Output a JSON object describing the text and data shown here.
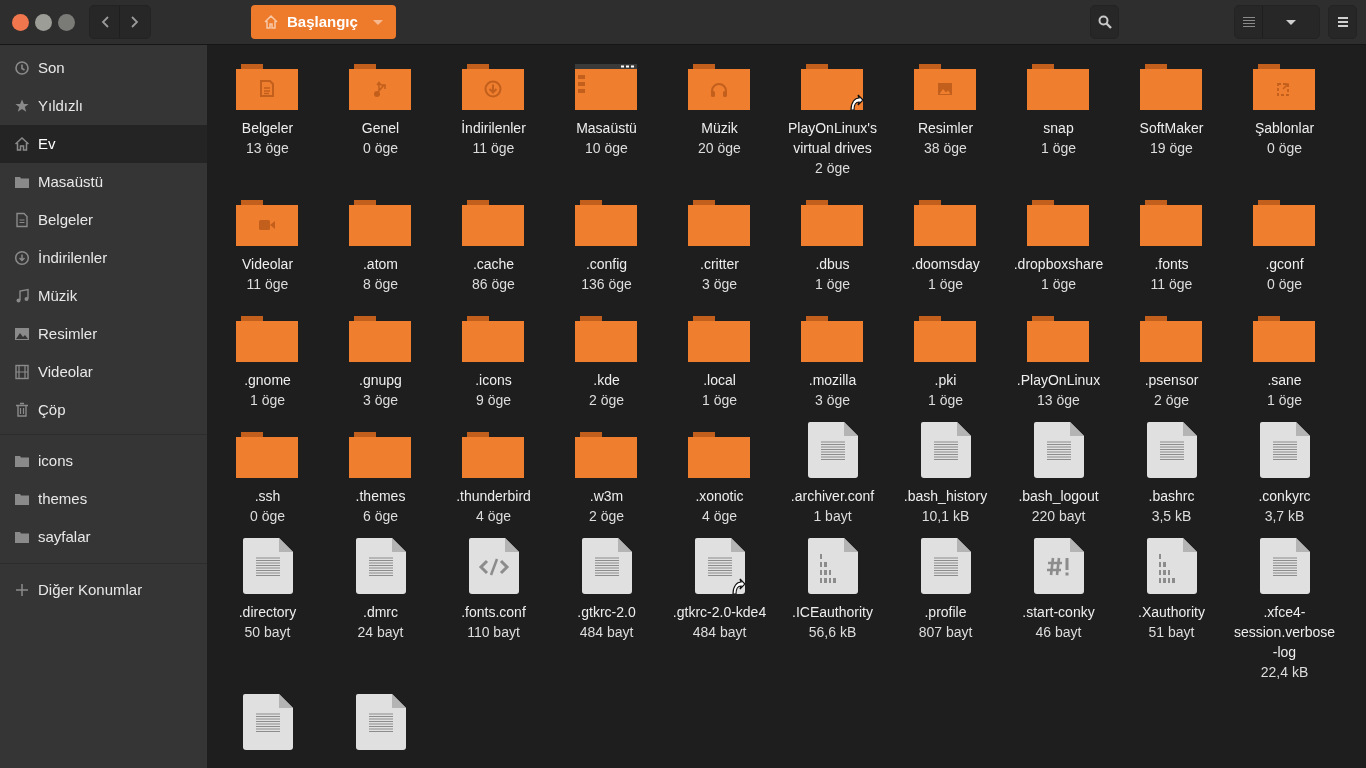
{
  "header": {
    "location": "Başlangıç"
  },
  "sidebar": {
    "sections": [
      {
        "items": [
          {
            "label": "Son",
            "kind": "recent",
            "selected": false
          },
          {
            "label": "Yıldızlı",
            "kind": "starred",
            "selected": false
          },
          {
            "label": "Ev",
            "kind": "home",
            "selected": true
          },
          {
            "label": "Masaüstü",
            "kind": "folder",
            "selected": false
          },
          {
            "label": "Belgeler",
            "kind": "document",
            "selected": false
          },
          {
            "label": "İndirilenler",
            "kind": "download",
            "selected": false
          },
          {
            "label": "Müzik",
            "kind": "music",
            "selected": false
          },
          {
            "label": "Resimler",
            "kind": "picture",
            "selected": false
          },
          {
            "label": "Videolar",
            "kind": "video",
            "selected": false
          },
          {
            "label": "Çöp",
            "kind": "trash",
            "selected": false
          }
        ]
      },
      {
        "items": [
          {
            "label": "icons",
            "kind": "folder",
            "selected": false
          },
          {
            "label": "themes",
            "kind": "folder",
            "selected": false
          },
          {
            "label": "sayfalar",
            "kind": "folder",
            "selected": false
          }
        ]
      },
      {
        "items": [
          {
            "label": "Diğer Konumlar",
            "kind": "add",
            "selected": false
          }
        ]
      }
    ]
  },
  "items": [
    {
      "name": "Belgeler",
      "size": "13 öge",
      "kind": "documents"
    },
    {
      "name": "Genel",
      "size": "0 öge",
      "kind": "share"
    },
    {
      "name": "İndirilenler",
      "size": "11 öge",
      "kind": "downloads"
    },
    {
      "name": "Masaüstü",
      "size": "10 öge",
      "kind": "desktop"
    },
    {
      "name": "Müzik",
      "size": "20 öge",
      "kind": "music"
    },
    {
      "name": "PlayOnLinux's virtual drives",
      "size": "2 öge",
      "kind": "folder",
      "link": true
    },
    {
      "name": "Resimler",
      "size": "38 öge",
      "kind": "pictures"
    },
    {
      "name": "snap",
      "size": "1 öge",
      "kind": "folder"
    },
    {
      "name": "SoftMaker",
      "size": "19 öge",
      "kind": "folder"
    },
    {
      "name": "Şablonlar",
      "size": "0 öge",
      "kind": "templates"
    },
    {
      "name": "Videolar",
      "size": "11 öge",
      "kind": "videos"
    },
    {
      "name": ".atom",
      "size": "8 öge",
      "kind": "folder"
    },
    {
      "name": ".cache",
      "size": "86 öge",
      "kind": "folder"
    },
    {
      "name": ".config",
      "size": "136 öge",
      "kind": "folder"
    },
    {
      "name": ".critter",
      "size": "3 öge",
      "kind": "folder"
    },
    {
      "name": ".dbus",
      "size": "1 öge",
      "kind": "folder"
    },
    {
      "name": ".doomsday",
      "size": "1 öge",
      "kind": "folder"
    },
    {
      "name": ".dropboxshare",
      "size": "1 öge",
      "kind": "folder"
    },
    {
      "name": ".fonts",
      "size": "11 öge",
      "kind": "folder"
    },
    {
      "name": ".gconf",
      "size": "0 öge",
      "kind": "folder"
    },
    {
      "name": ".gnome",
      "size": "1 öge",
      "kind": "folder"
    },
    {
      "name": ".gnupg",
      "size": "3 öge",
      "kind": "folder"
    },
    {
      "name": ".icons",
      "size": "9 öge",
      "kind": "folder"
    },
    {
      "name": ".kde",
      "size": "2 öge",
      "kind": "folder"
    },
    {
      "name": ".local",
      "size": "1 öge",
      "kind": "folder"
    },
    {
      "name": ".mozilla",
      "size": "3 öge",
      "kind": "folder"
    },
    {
      "name": ".pki",
      "size": "1 öge",
      "kind": "folder"
    },
    {
      "name": ".PlayOnLinux",
      "size": "13 öge",
      "kind": "folder"
    },
    {
      "name": ".psensor",
      "size": "2 öge",
      "kind": "folder"
    },
    {
      "name": ".sane",
      "size": "1 öge",
      "kind": "folder"
    },
    {
      "name": ".ssh",
      "size": "0 öge",
      "kind": "folder"
    },
    {
      "name": ".themes",
      "size": "6 öge",
      "kind": "folder"
    },
    {
      "name": ".thunderbird",
      "size": "4 öge",
      "kind": "folder"
    },
    {
      "name": ".w3m",
      "size": "2 öge",
      "kind": "folder"
    },
    {
      "name": ".xonotic",
      "size": "4 öge",
      "kind": "folder"
    },
    {
      "name": ".archiver.conf",
      "size": "1 bayt",
      "kind": "text"
    },
    {
      "name": ".bash_history",
      "size": "10,1 kB",
      "kind": "text"
    },
    {
      "name": ".bash_logout",
      "size": "220 bayt",
      "kind": "text"
    },
    {
      "name": ".bashrc",
      "size": "3,5 kB",
      "kind": "text"
    },
    {
      "name": ".conkyrc",
      "size": "3,7 kB",
      "kind": "text"
    },
    {
      "name": ".directory",
      "size": "50 bayt",
      "kind": "text"
    },
    {
      "name": ".dmrc",
      "size": "24 bayt",
      "kind": "text"
    },
    {
      "name": ".fonts.conf",
      "size": "110 bayt",
      "kind": "code"
    },
    {
      "name": ".gtkrc-2.0",
      "size": "484 bayt",
      "kind": "text"
    },
    {
      "name": ".gtkrc-2.0-kde4",
      "size": "484 bayt",
      "kind": "text",
      "link": true
    },
    {
      "name": ".ICEauthority",
      "size": "56,6 kB",
      "kind": "binary"
    },
    {
      "name": ".profile",
      "size": "807 bayt",
      "kind": "text"
    },
    {
      "name": ".start-conky",
      "size": "46 bayt",
      "kind": "script"
    },
    {
      "name": ".Xauthority",
      "size": "51 bayt",
      "kind": "binary"
    },
    {
      "name": ".xfce4-session.verbose-log",
      "size": "22,4 kB",
      "kind": "text"
    },
    {
      "kind": "text"
    },
    {
      "kind": "text"
    }
  ]
}
